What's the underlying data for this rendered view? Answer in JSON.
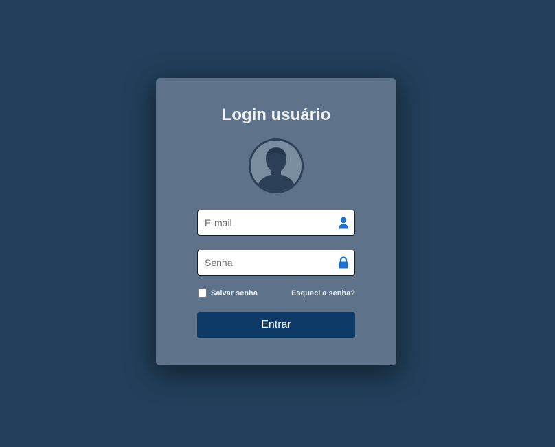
{
  "login": {
    "title": "Login usuário",
    "email_placeholder": "E-mail",
    "password_placeholder": "Senha",
    "remember_label": "Salvar senha",
    "remember_checked": false,
    "forgot_label": "Esqueci a senha?",
    "submit_label": "Entrar",
    "email_icon": "user-icon",
    "password_icon": "lock-icon",
    "avatar_icon": "user-silhouette-icon"
  },
  "colors": {
    "page_background": "#22405c",
    "card_background": "#5e7289",
    "button": "#0d3a66",
    "icon_accent": "#1a6fd0"
  }
}
